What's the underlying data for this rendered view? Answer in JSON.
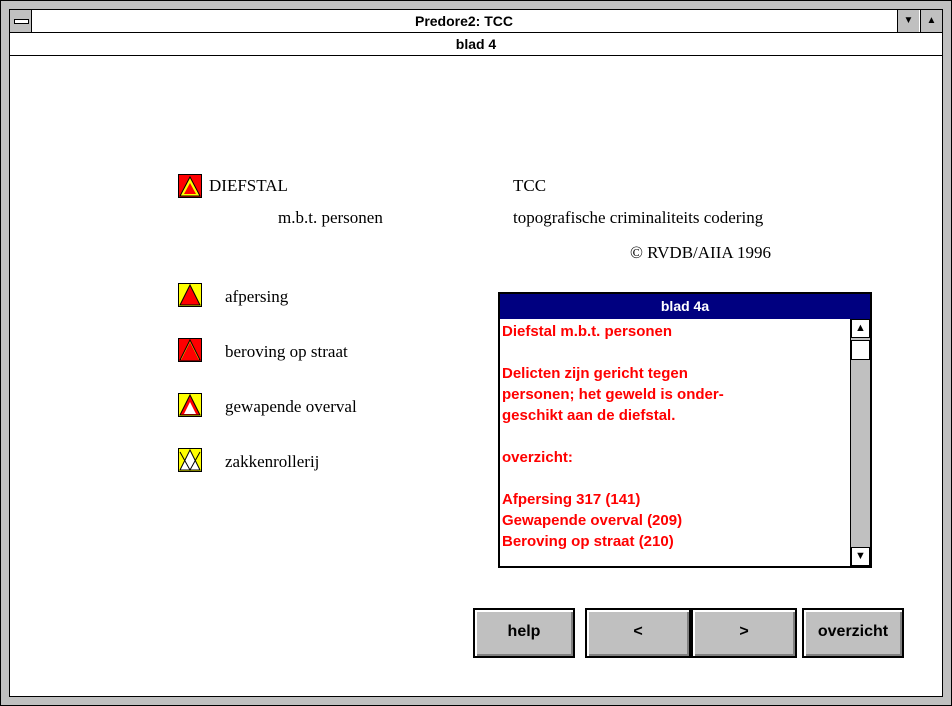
{
  "window": {
    "title": "Predore2: TCC",
    "subtitle": "blad 4"
  },
  "colors": {
    "accent": "#000080",
    "text_red": "#ff0000",
    "icon_red": "#ff0000",
    "icon_yellow": "#ffff00",
    "face": "#c0c0c0"
  },
  "header": {
    "main_label": "DIEFSTAL",
    "main_sub": "m.b.t. personen",
    "tcc_title": "TCC",
    "tcc_desc": "topografische criminaliteits codering",
    "copyright": "© RVDB/AIIA 1996"
  },
  "legend": [
    {
      "label": "afpersing",
      "icon": "filled-red-triangle-icon"
    },
    {
      "label": "beroving op straat",
      "icon": "red-triangle-icon"
    },
    {
      "label": "gewapende overval",
      "icon": "outlined-triangle-icon"
    },
    {
      "label": "zakkenrollerij",
      "icon": "crossed-triangle-icon"
    }
  ],
  "panel": {
    "title": "blad 4a",
    "lines": [
      "Diefstal m.b.t. personen",
      "",
      "Delicten zijn gericht tegen",
      "personen; het geweld is onder-",
      "geschikt aan de diefstal.",
      "",
      "overzicht:",
      "",
      "Afpersing 317 (141)",
      "Gewapende overval (209)",
      "Beroving op straat (210)"
    ]
  },
  "buttons": {
    "help": "help",
    "prev": "<",
    "next": ">",
    "overview": "overzicht"
  }
}
